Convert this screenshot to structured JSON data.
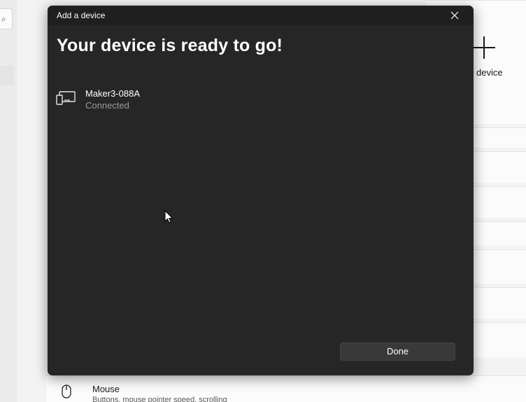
{
  "background": {
    "add_device": {
      "label": "device",
      "icon": "plus-icon"
    },
    "mouse_row": {
      "icon": "mouse-icon",
      "title": "Mouse",
      "subtitle": "Buttons, mouse pointer speed, scrolling"
    }
  },
  "dialog": {
    "title": "Add a device",
    "close_icon": "close-icon",
    "heading": "Your device is ready to go!",
    "device": {
      "icon": "display-device-icon",
      "name": "Maker3-088A",
      "status": "Connected"
    },
    "done_label": "Done"
  },
  "colors": {
    "dialog_bg": "#262626",
    "titlebar_bg": "#1f1f1f",
    "button_bg": "#393939",
    "status_text": "#9a9a9a",
    "page_bg": "#f3f3f3"
  }
}
